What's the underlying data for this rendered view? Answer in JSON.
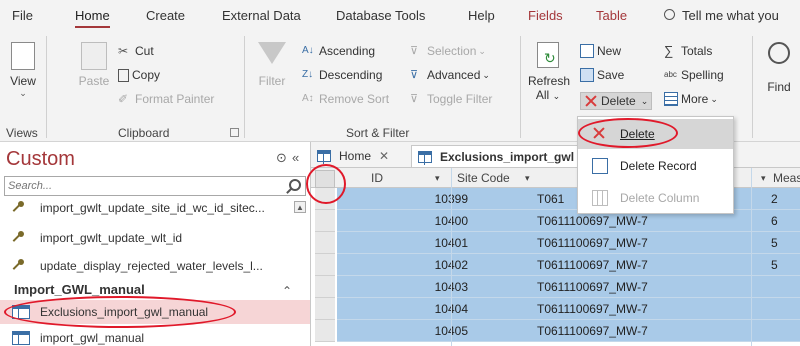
{
  "menu_tabs": [
    "File",
    "Home",
    "Create",
    "External Data",
    "Database Tools",
    "Help",
    "Fields",
    "Table"
  ],
  "tell_me": "Tell me what you",
  "ribbon": {
    "views": {
      "view_label": "View",
      "group": "Views"
    },
    "clipboard": {
      "paste": "Paste",
      "cut": "Cut",
      "copy": "Copy",
      "format_painter": "Format Painter",
      "group": "Clipboard"
    },
    "sort_filter": {
      "filter": "Filter",
      "ascending": "Ascending",
      "descending": "Descending",
      "remove_sort": "Remove Sort",
      "selection": "Selection",
      "advanced": "Advanced",
      "toggle_filter": "Toggle Filter",
      "group": "Sort & Filter"
    },
    "records": {
      "refresh_line1": "Refresh",
      "refresh_line2": "All",
      "new": "New",
      "save": "Save",
      "delete": "Delete",
      "totals": "Totals",
      "spelling": "Spelling",
      "more": "More"
    },
    "find": {
      "find": "Find"
    }
  },
  "nav": {
    "title": "Custom",
    "search_placeholder": "Search...",
    "items_top": [
      "import_gwlt_update_site_id_wc_id_sitec...",
      "import_gwlt_update_wlt_id",
      "update_display_rejected_water_levels_l..."
    ],
    "group": "Import_GWL_manual",
    "items_group": [
      "Exclusions_import_gwl_manual",
      "import_gwl_manual"
    ]
  },
  "doc_tabs": {
    "home": "Home",
    "active": "Exclusions_import_gwl"
  },
  "grid": {
    "columns": {
      "id": "ID",
      "site": "Site Code",
      "meas": "Meas"
    },
    "rows": [
      {
        "id": "10399",
        "site": "T061",
        "meas": "2"
      },
      {
        "id": "10400",
        "site": "T0611100697_MW-7",
        "meas": "6"
      },
      {
        "id": "10401",
        "site": "T0611100697_MW-7",
        "meas": "5"
      },
      {
        "id": "10402",
        "site": "T0611100697_MW-7",
        "meas": "5"
      },
      {
        "id": "10403",
        "site": "T0611100697_MW-7",
        "meas": ""
      },
      {
        "id": "10404",
        "site": "T0611100697_MW-7",
        "meas": ""
      },
      {
        "id": "10405",
        "site": "T0611100697_MW-7",
        "meas": ""
      }
    ]
  },
  "delete_menu": [
    "Delete",
    "Delete Record",
    "Delete Column"
  ],
  "colors": {
    "accent": "#a4373a",
    "selection": "#a9cae8",
    "annotation": "#e0192a"
  }
}
